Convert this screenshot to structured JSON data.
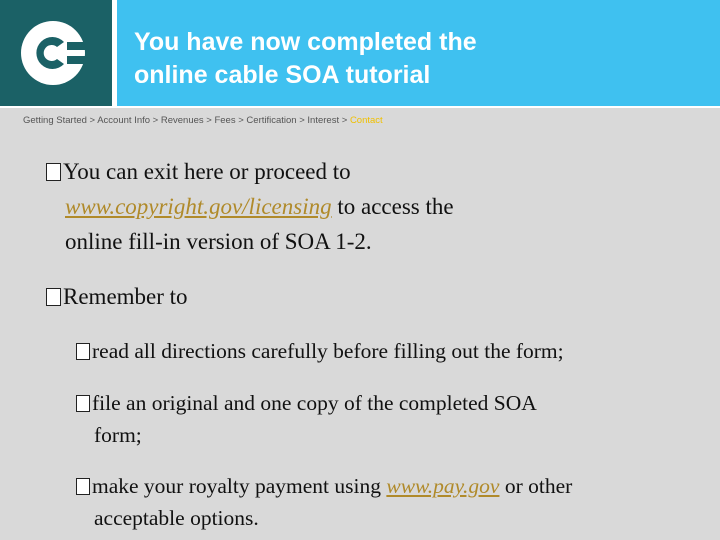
{
  "header": {
    "logo_icon": "copyright-c-logo-icon",
    "title_line1": "You have now completed the",
    "title_line2": "online cable SOA tutorial"
  },
  "breadcrumb": {
    "items": [
      "Getting Started",
      "Account Info",
      "Revenues",
      "Fees",
      "Certification",
      "Interest"
    ],
    "separator": " > ",
    "current": "Contact"
  },
  "content": {
    "bullet1": {
      "line1": "You can exit here or proceed to",
      "link": "www.copyright.gov/licensing",
      "after_link": " to access the",
      "line3": "online fill-in version of SOA 1-2."
    },
    "bullet2": {
      "text": "Remember to"
    },
    "sub_items": [
      {
        "line1": "read all directions carefully before filling out the form;"
      },
      {
        "line1": "file an original and one copy of the completed SOA",
        "line2": "form;"
      },
      {
        "before_link": "make your royalty payment using ",
        "link": "www.pay.gov",
        "after_link": " or other",
        "line2": "acceptable options."
      }
    ]
  },
  "colors": {
    "title_bg": "#3fc1f0",
    "logo_bg": "#1b6166",
    "page_bg": "#d9d9d9",
    "link": "#b08a2a",
    "breadcrumb_current": "#f0c000"
  }
}
